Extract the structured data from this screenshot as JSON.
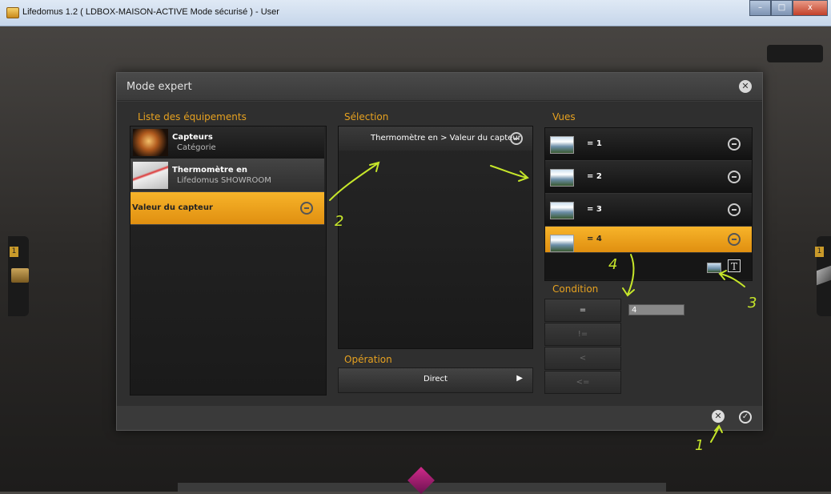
{
  "window": {
    "title": "Lifedomus 1.2 ( LDBOX-MAISON-ACTIVE Mode sécurisé ) - User",
    "min": "–",
    "max": "□",
    "close": "x"
  },
  "side": {
    "left_badge": "1",
    "right_badge": "1"
  },
  "dialog": {
    "title": "Mode expert",
    "close_icon": "close-icon",
    "equipements": {
      "header": "Liste des équipements",
      "items": [
        {
          "title": "Capteurs",
          "subtitle": "Catégorie"
        },
        {
          "title": "Thermomètre en",
          "subtitle": "Lifedomus SHOWROOM"
        }
      ],
      "selected": "Valeur du capteur"
    },
    "selection": {
      "header": "Sélection",
      "item": "Thermomètre en > Valeur du capteur",
      "operation_header": "Opération",
      "operation_value": "Direct"
    },
    "vues": {
      "header": "Vues",
      "items": [
        "= 1",
        "= 2",
        "= 3",
        "= 4"
      ],
      "selected_index": 3
    },
    "condition": {
      "header": "Condition",
      "operators": [
        "=",
        "!=",
        "<",
        "<="
      ],
      "value": "4"
    }
  },
  "annotations": [
    "1",
    "2",
    "3",
    "4"
  ],
  "colors": {
    "accent": "#f0a418",
    "header_text": "#e7a220",
    "annotation": "#c6e62a"
  }
}
